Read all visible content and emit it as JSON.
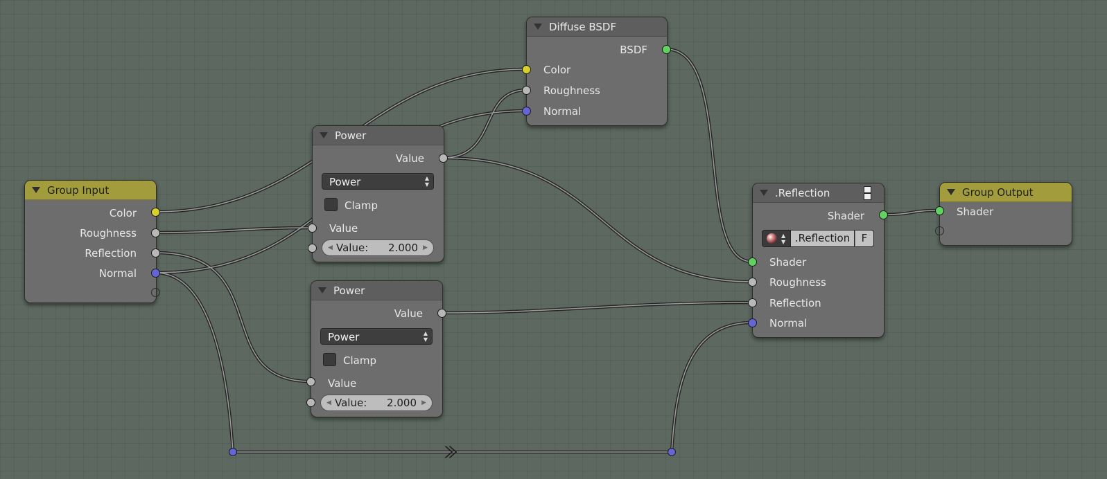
{
  "nodes": {
    "group_input": {
      "title": "Group Input",
      "outputs": [
        "Color",
        "Roughness",
        "Reflection",
        "Normal"
      ]
    },
    "diffuse_bsdf": {
      "title": "Diffuse BSDF",
      "output": "BSDF",
      "inputs": [
        "Color",
        "Roughness",
        "Normal"
      ]
    },
    "power_1": {
      "title": "Power",
      "output": "Value",
      "operation": "Power",
      "clamp_label": "Clamp",
      "input_label": "Value",
      "field_label": "Value:",
      "field_value": "2.000"
    },
    "power_2": {
      "title": "Power",
      "output": "Value",
      "operation": "Power",
      "clamp_label": "Clamp",
      "input_label": "Value",
      "field_label": "Value:",
      "field_value": "2.000"
    },
    "reflection": {
      "title": ".Reflection",
      "output": "Shader",
      "group_name": ".Reflection",
      "fake_user": "F",
      "inputs": [
        "Shader",
        "Roughness",
        "Reflection",
        "Normal"
      ]
    },
    "group_output": {
      "title": "Group Output",
      "input": "Shader"
    }
  },
  "socket_colors": {
    "color": "#d8d02c",
    "value": "#b8b8b8",
    "vector": "#6565d6",
    "shader": "#62d162"
  }
}
